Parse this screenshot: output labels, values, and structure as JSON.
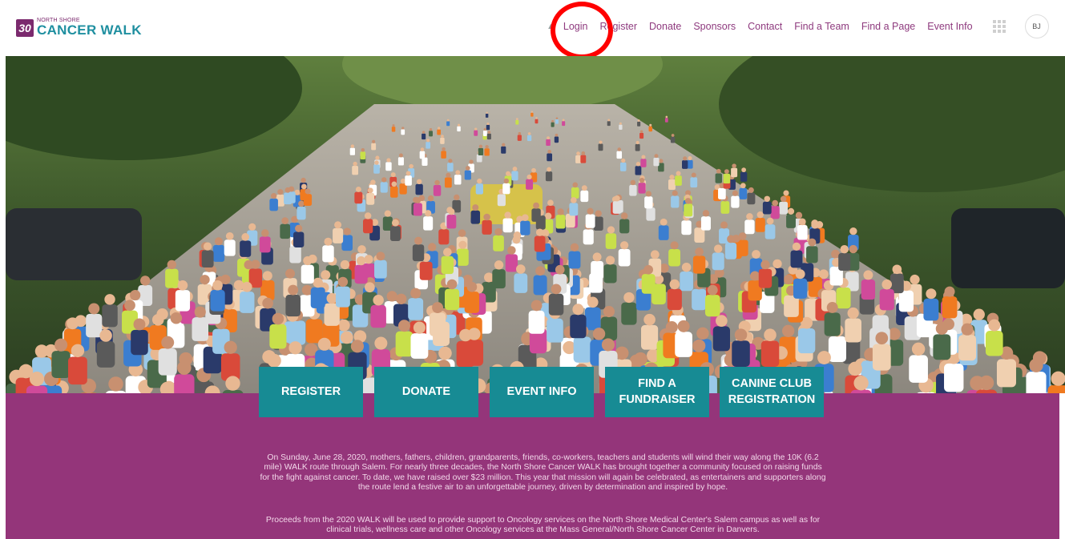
{
  "logo": {
    "badge": "30",
    "small": "NORTH SHORE",
    "big": "CANCER WALK"
  },
  "nav": {
    "items": [
      "Login",
      "Register",
      "Donate",
      "Sponsors",
      "Contact",
      "Find a Team",
      "Find a Page",
      "Event Info"
    ],
    "avatar": "BJ"
  },
  "cta": [
    "REGISTER",
    "DONATE",
    "EVENT INFO",
    "FIND A\nFUNDRAISER",
    "CANINE CLUB\nREGISTRATION"
  ],
  "body": {
    "p1": "On Sunday, June 28, 2020, mothers, fathers, children, grandparents, friends, co-workers, teachers and students will wind their way along the 10K (6.2 mile) WALK route through Salem.  For nearly three decades, the North Shore Cancer WALK has brought together a community focused on raising funds for the fight against cancer.  To date, we have raised over $23 million.  This year that mission will again be celebrated, as entertainers and supporters along the route lend a festive air to an unforgettable journey, driven by determination and inspired by hope.",
    "p2": "Proceeds from the 2020 WALK will be used to provide support to Oncology services on the North Shore Medical Center's Salem campus as well as for clinical trials, wellness care and other Oncology services at the Mass General/North Shore Cancer Center in Danvers."
  },
  "colors": {
    "brand_purple": "#94357a",
    "teal_button": "#178b94",
    "nav_text": "#8e3a7e",
    "highlight_circle": "#ff0000"
  },
  "icons": {
    "apps": "grid-icon",
    "arrow": "caret-icon"
  }
}
